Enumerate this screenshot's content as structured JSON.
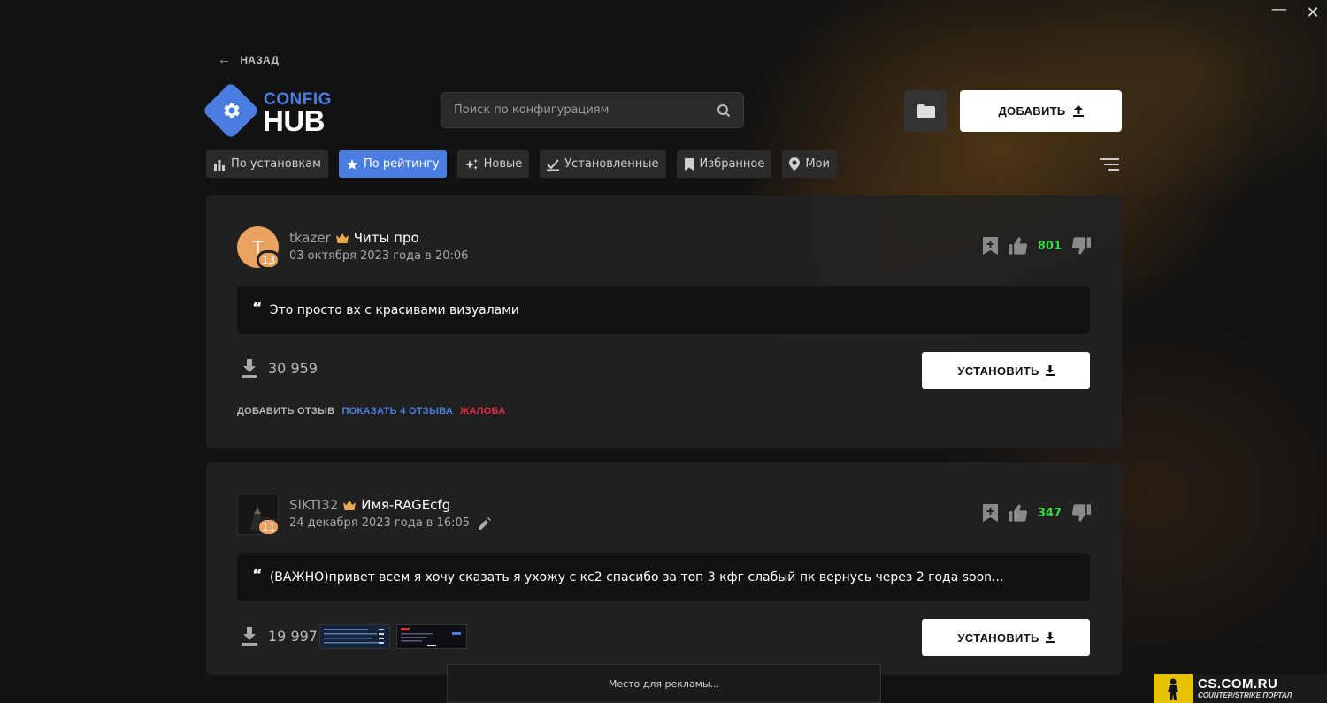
{
  "window": {
    "minimize": "—",
    "close": "✕"
  },
  "back_label": "НАЗАД",
  "logo": {
    "line1": "CONFIG",
    "line2": "HUB"
  },
  "search": {
    "placeholder": "Поиск по конфигурациям"
  },
  "add_button": "ДОБАВИТЬ",
  "accent_color": "#4a7ddf",
  "tabs": [
    {
      "label": "По установкам",
      "icon": "bar-chart-icon",
      "active": false
    },
    {
      "label": "По рейтингу",
      "icon": "star-icon",
      "active": true
    },
    {
      "label": "Новые",
      "icon": "sparkle-icon",
      "active": false
    },
    {
      "label": "Установленные",
      "icon": "check-icon",
      "active": false
    },
    {
      "label": "Избранное",
      "icon": "bookmark-icon",
      "active": false
    },
    {
      "label": "Мои",
      "icon": "location-pin-icon",
      "active": false
    }
  ],
  "configs": [
    {
      "avatar_letter": "T",
      "level": "13",
      "nickname": "tkazer",
      "config_name": "Читы про",
      "date": "03 октября 2023 года в 20:06",
      "likes": "801",
      "description": "Это просто вх с красивами визуалами",
      "downloads": "30 959",
      "install_label": "УСТАНОВИТЬ",
      "add_review": "ДОБАВИТЬ ОТЗЫВ",
      "show_reviews": "ПОКАЗАТЬ 4 ОТЗЫВА",
      "report": "ЖАЛОБА"
    },
    {
      "level": "11",
      "nickname": "SIKTI32",
      "config_name": "Имя-RAGEcfg",
      "date": "24 декабря 2023 года в 16:05",
      "likes": "347",
      "description": "(ВАЖНО)привет всем я хочу сказать я ухожу с кс2 спасибо за топ 3 кфг слабый пк вернусь через 2 года soon...",
      "downloads": "19 997",
      "install_label": "УСТАНОВИТЬ"
    }
  ],
  "quote_mark": "“",
  "ad_text": "Место для рекламы...",
  "watermark": {
    "line1": "CS.COM.RU",
    "line2": "COUNTER/STRIKE ПОРТАЛ"
  }
}
